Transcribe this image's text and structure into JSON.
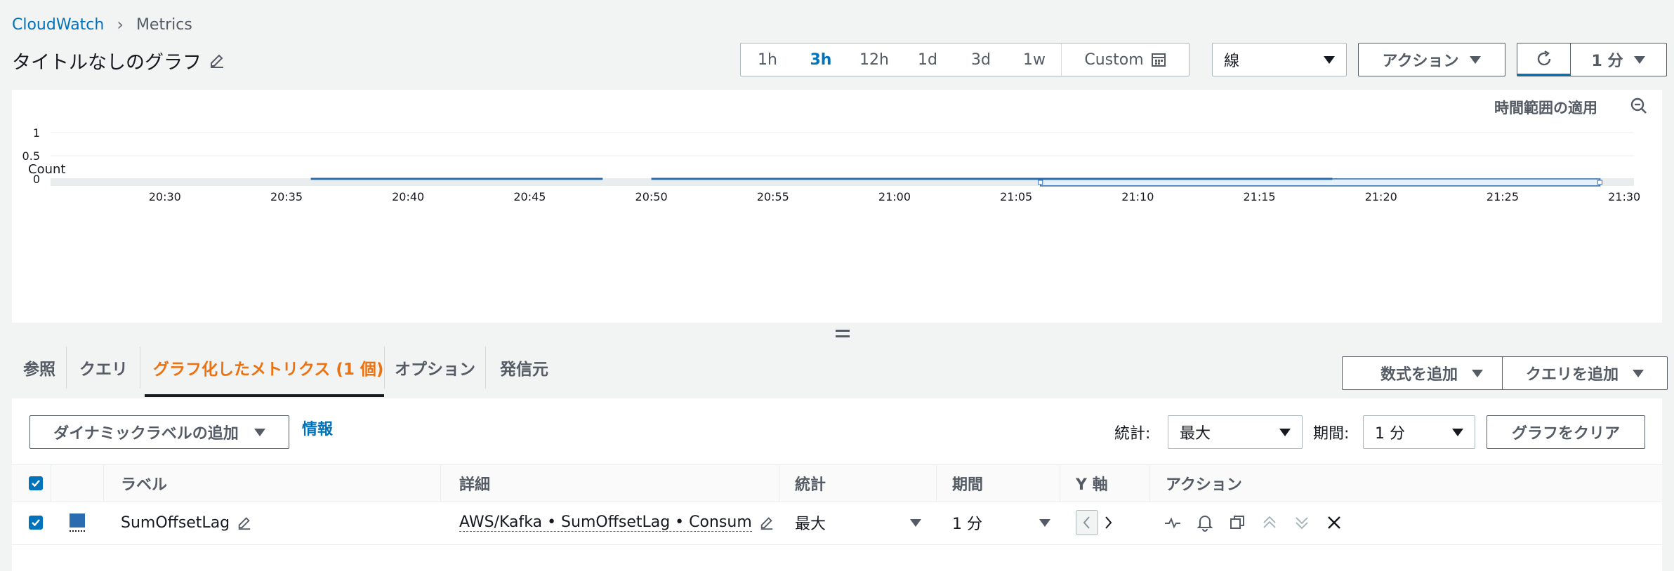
{
  "breadcrumb": {
    "root": "CloudWatch",
    "current": "Metrics"
  },
  "graph_title": "タイトルなしのグラフ",
  "time_ranges": [
    "1h",
    "3h",
    "12h",
    "1d",
    "3d",
    "1w",
    "Custom"
  ],
  "active_time_range": "3h",
  "chart_type_select": "線",
  "actions_button": "アクション",
  "refresh_interval": "1 分",
  "chart_panel": {
    "apply_time_range": "時間範囲の適用"
  },
  "chart_data": {
    "type": "line",
    "ylabel": "Count",
    "ylim": [
      0,
      1
    ],
    "yticks": [
      "1",
      "0.5",
      "0"
    ],
    "xticks": [
      "20:30",
      "20:35",
      "20:40",
      "20:45",
      "20:50",
      "20:55",
      "21:00",
      "21:05",
      "21:10",
      "21:15",
      "21:20",
      "21:25",
      "21:30"
    ],
    "series": [
      {
        "name": "SumOffsetLag",
        "color": "#1f77b4",
        "segments": [
          {
            "start": "20:36",
            "end": "20:48",
            "value": 0
          },
          {
            "start": "20:50",
            "end": "21:18",
            "value": 0
          }
        ]
      }
    ],
    "selected_range": {
      "start": "21:06",
      "end": "21:29"
    }
  },
  "tabs": [
    "参照",
    "クエリ",
    "グラフ化したメトリクス (1 個)",
    "オプション",
    "発信元"
  ],
  "active_tab": "グラフ化したメトリクス (1 個)",
  "add_math_button": "数式を追加",
  "add_query_button": "クエリを追加",
  "dynamic_label_button": "ダイナミックラベルの追加",
  "info_link": "情報",
  "stat_label": "統計:",
  "stat_value": "最大",
  "period_label": "期間:",
  "period_value": "1 分",
  "clear_graph_button": "グラフをクリア",
  "table": {
    "headers": {
      "label": "ラベル",
      "details": "詳細",
      "stat": "統計",
      "period": "期間",
      "y_axis": "Y 軸",
      "actions": "アクション"
    },
    "rows": [
      {
        "color": "#1f77b4",
        "label": "SumOffsetLag",
        "details": "AWS/Kafka • SumOffsetLag • Consumer Group",
        "stat": "最大",
        "period": "1 分"
      }
    ]
  },
  "accent_color": "#0073bb",
  "active_tab_color": "#ec7211"
}
